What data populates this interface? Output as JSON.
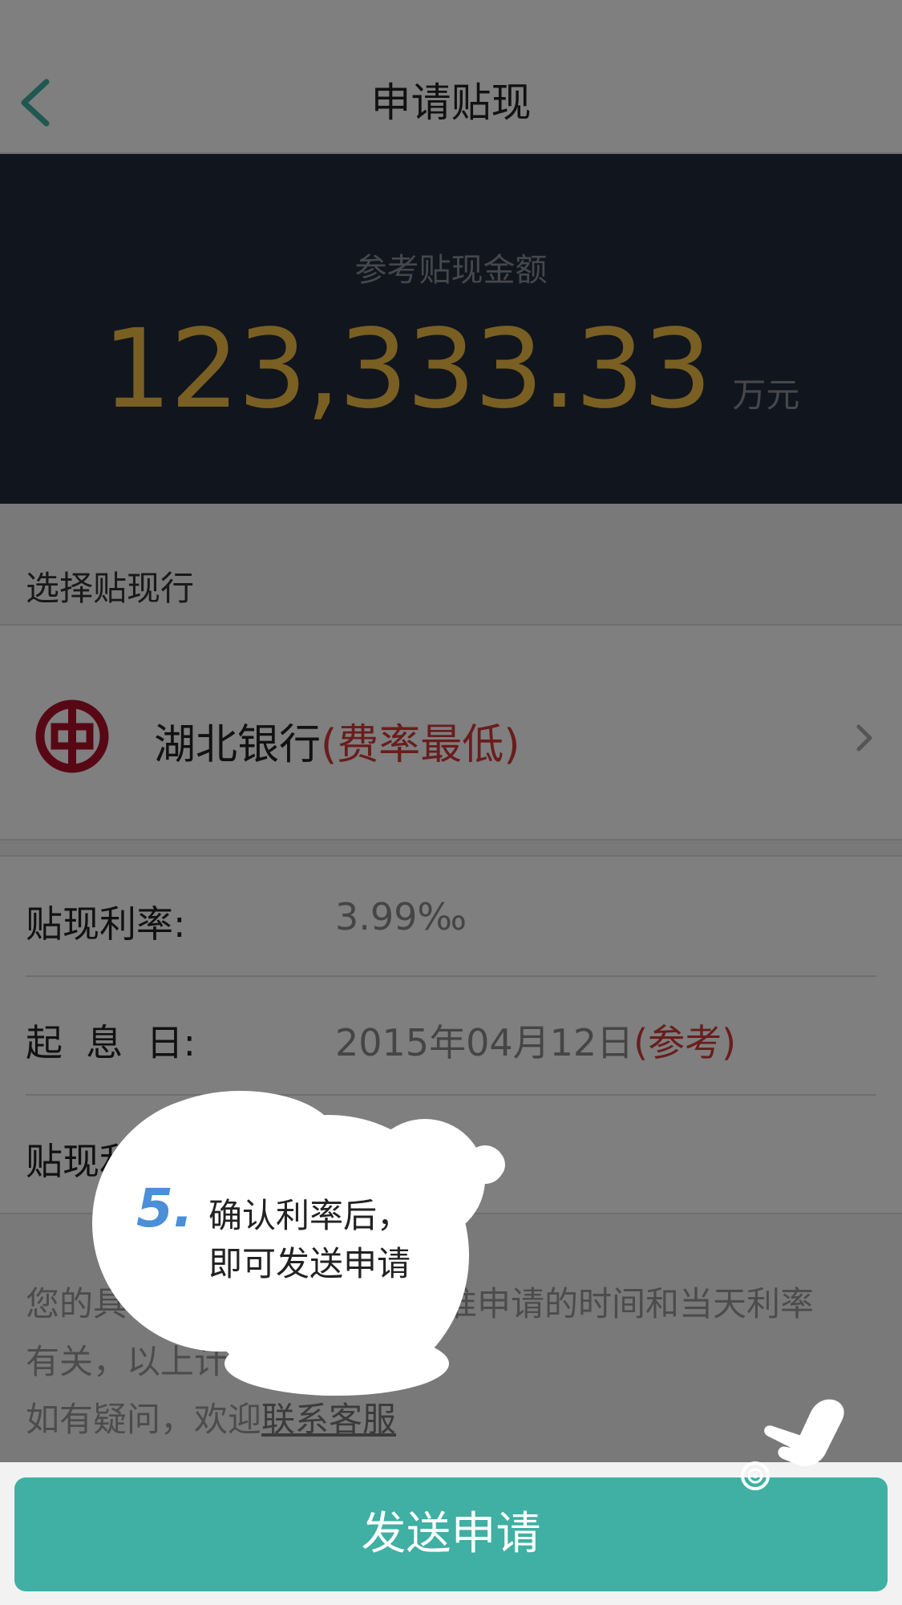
{
  "nav": {
    "title": "申请贴现"
  },
  "hero": {
    "label": "参考贴现金额",
    "amount": "123,333.33",
    "unit": "万元"
  },
  "bank_section": {
    "label": "选择贴现行",
    "bank_name": "湖北银行",
    "bank_tag": "(费率最低)"
  },
  "info": {
    "rate_label": "贴现利率:",
    "rate_value": "3.99‰",
    "start_label": "起  息  日:",
    "start_value": "2015年04月12日",
    "start_tag": "(参考)",
    "third_label": "贴现利"
  },
  "notes": {
    "line1a": "您的具",
    "line1b": "准申请的时间和当天利率",
    "line2a": "有关，以上计",
    "line3a": "如有疑问，欢迎",
    "link": "联系客服"
  },
  "tutorial": {
    "step": "5.",
    "line1": "确认利率后，",
    "line2": "即可发送申请"
  },
  "button": {
    "label": "发送申请"
  },
  "colors": {
    "accent": "#3fb0a3",
    "hero_bg": "#232a3b",
    "amount": "#f3bf45",
    "highlight_red": "#d23b3b"
  },
  "icons": {
    "back": "chevron-left-icon",
    "bank": "bank-of-china-logo-icon",
    "next": "chevron-right-icon",
    "hand": "pointing-hand-icon"
  }
}
